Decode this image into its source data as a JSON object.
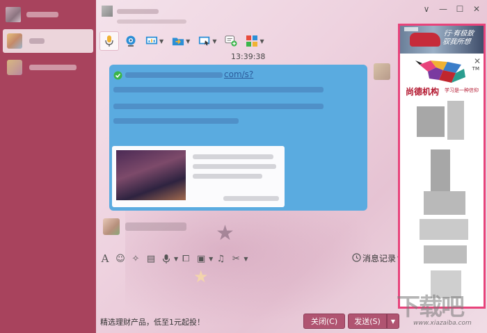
{
  "window": {
    "controls": {
      "menu": "∨",
      "minimize": "—",
      "maximize": "☐",
      "close": "✕"
    }
  },
  "toolbar": {
    "items": [
      {
        "name": "voice-call",
        "icon": "microphone-icon",
        "selected": true,
        "dropdown": false
      },
      {
        "name": "video-call",
        "icon": "webcam-icon",
        "dropdown": false
      },
      {
        "name": "remote-demo",
        "icon": "presentation-icon",
        "dropdown": true
      },
      {
        "name": "send-file",
        "icon": "folder-send-icon",
        "dropdown": true
      },
      {
        "name": "remote-desktop",
        "icon": "remote-desktop-icon",
        "dropdown": true
      },
      {
        "name": "create-discussion",
        "icon": "chat-add-icon",
        "dropdown": false
      },
      {
        "name": "apps",
        "icon": "apps-grid-icon",
        "dropdown": true
      }
    ]
  },
  "chat": {
    "timestamp": "13:39:38",
    "link_title_visible": "com/s?",
    "input_tools": [
      {
        "name": "font",
        "glyph": "A"
      },
      {
        "name": "emoji",
        "glyph": "☺"
      },
      {
        "name": "shake",
        "glyph": "✧"
      },
      {
        "name": "gif",
        "glyph": "▤"
      },
      {
        "name": "voice-message",
        "glyph": "🎙"
      },
      {
        "name": "screenshot",
        "glyph": "⧠"
      },
      {
        "name": "image",
        "glyph": "▣"
      },
      {
        "name": "music",
        "glyph": "♫"
      },
      {
        "name": "scissors",
        "glyph": "✂"
      }
    ],
    "history_label": "消息记录"
  },
  "footer": {
    "ad_text": "精选理财产品，低至1元起投！",
    "close_button": "关闭(C)",
    "send_button": "发送(S)",
    "send_caret": "▼"
  },
  "ad_panel": {
    "banner_text_line1": "行·有极致",
    "banner_text_line2": "驭我所想",
    "close": "✕",
    "trademark": "TM",
    "org_name": "尚德机构",
    "slogan": "学习是一种信仰",
    "border_color": "#e8437b"
  },
  "watermark": {
    "text": "下载吧",
    "url": "www.xiazaiba.com"
  },
  "colors": {
    "sidebar": "#a8435d",
    "bubble": "#5aabe0",
    "button": "#b05471"
  }
}
